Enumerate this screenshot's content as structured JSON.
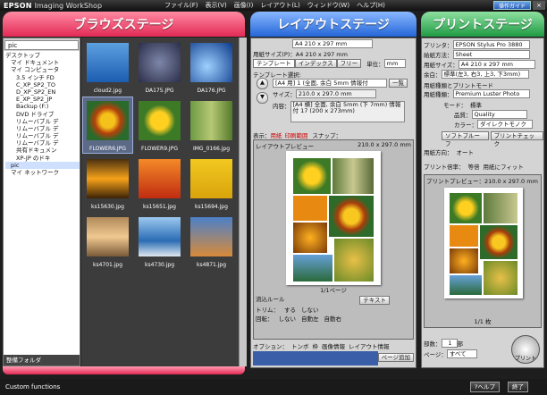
{
  "app": {
    "brand": "EPSON",
    "title": "Imaging WorkShop",
    "menus": [
      "ファイル(F)",
      "表示(V)",
      "画像(I)",
      "レイアウト(L)",
      "ウィンドウ(W)",
      "ヘルプ(H)"
    ],
    "guide": "操作ガイド",
    "close": "×"
  },
  "stages": {
    "browse": "ブラウズステージ",
    "layout": "レイアウトステージ",
    "print": "プリントステージ"
  },
  "browse": {
    "folder": "pic",
    "tree": [
      "デスクトップ",
      "マイ ドキュメント",
      "マイ コンピュータ",
      "3.5 インチ FD",
      "C_XP_SP2_TO",
      "D_XP_SP2_EN",
      "E_XP_SP2_JP",
      "Backup (F:)",
      "DVD ドライブ",
      "リムーバブル デ",
      "リムーバブル デ",
      "リムーバブル デ",
      "リムーバブル デ",
      "共有ドキュメン",
      "XP-JP のドキ",
      "pic",
      "マイ ネットワーク"
    ],
    "footer": "整備フォルダ",
    "thumbs": [
      "cloud2.jpg",
      "DA175.JPG",
      "DA176.JPG",
      "FLOWER6.JPG",
      "FLOWER9.JPG",
      "IMG_0166.jpg",
      "ks15630.jpg",
      "ks15651.jpg",
      "ks15694.jpg",
      "ks4701.jpg",
      "ks4730.jpg",
      "ks4871.jpg"
    ]
  },
  "layout": {
    "paper": "A4 210 x 297 mm",
    "userpaper": "用紙サイズ(P)：A4 210 x 297 mm",
    "tabs": [
      "テンプレート",
      "インデックス",
      "フリー"
    ],
    "unit_label": "単位：",
    "unit": "mm",
    "template_label": "テンプレート選択:",
    "template": "[A4 用] 1 (全面, 余白 5mm 情報付",
    "list_btn": "一覧",
    "size_label": "サイズ：",
    "size": "210.0 x 297.0 mm",
    "content_label": "内容：",
    "content": "[A4 横] 全面, 余白 5mm (下 7mm) 情報付 17 (200 x 273mm)",
    "view_label": "表示：",
    "view_opts": [
      "用紙",
      "印刷範囲"
    ],
    "snap": "スナップ：",
    "preview_label": "レイアウトプレビュー",
    "preview_size": "210.0 x 297.0 mm",
    "page_no": "1/1ページ",
    "flow_label": "流込ルール",
    "text_btn": "テキスト",
    "trim_label": "トリム：",
    "trim_opts": [
      "する",
      "しない"
    ],
    "rotate_label": "回転：",
    "rotate_opts": [
      "しない",
      "自動左",
      "自動右"
    ],
    "option_label": "オプション：",
    "options": [
      "トンボ",
      "枠",
      "画像情報",
      "レイアウト情報"
    ],
    "page_add": "ページ追加"
  },
  "print": {
    "printer_label": "プリンタ：",
    "printer": "EPSON Stylus Pro 3880",
    "feed_label": "給紙方法：",
    "feed": "Sheet",
    "size_label": "用紙サイズ：",
    "size": "A4 210 x 297 mm",
    "margin_label": "余白：",
    "margin": "標準(左3, 右3, 上3, 下3mm)",
    "mode_label": "用紙種類とプリントモード",
    "media_label": "用紙種類：",
    "media": "Premium Luster Photo Paper",
    "mode_row": "モード：",
    "mode": "標準",
    "quality_label": "品質：",
    "quality": "Quality",
    "color_label": "カラー：",
    "color": "ダイレクトモノクロ",
    "btn1": "ソフトプルーフ",
    "btn2": "プリントチェック",
    "orient_label": "用紙方向：",
    "orient": "オート",
    "size_mode_label": "プリント倍率：",
    "size_mode": "等倍",
    "fit": "用紙にフィット",
    "preview_label": "プリントプレビュー：210.0 x 297.0 mm",
    "page_no": "1/1 枚",
    "copies_label": "部数：",
    "copies": "1",
    "copies_unit": "部",
    "page_label": "ページ：",
    "page": "すべて",
    "print_btn": "プリント"
  },
  "status": {
    "text": "Custom functions",
    "help": "?ヘルプ",
    "exit": "終了"
  }
}
